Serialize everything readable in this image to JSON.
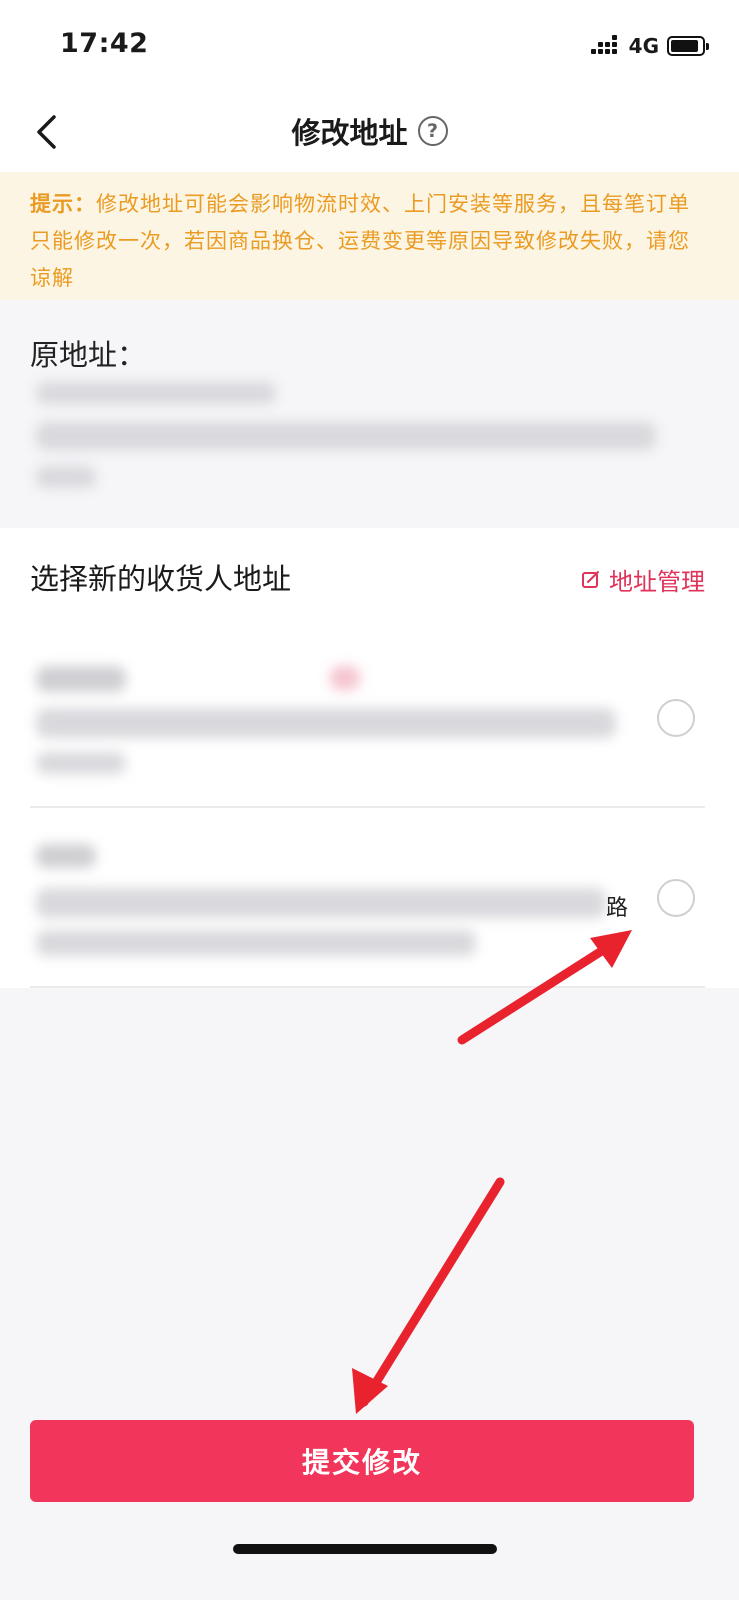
{
  "status_bar": {
    "time": "17:42",
    "network": "4G"
  },
  "header": {
    "title": "修改地址"
  },
  "notice": {
    "label": "提示：",
    "text": "修改地址可能会影响物流时效、上门安装等服务，且每笔订单只能修改一次，若因商品换仓、运费变更等原因导致修改失败，请您谅解"
  },
  "original_address": {
    "label": "原地址："
  },
  "new_address": {
    "title": "选择新的收货人地址",
    "manage_label": "地址管理",
    "items": [
      {
        "selected": false,
        "tail": ""
      },
      {
        "selected": false,
        "tail": "路"
      }
    ]
  },
  "submit": {
    "label": "提交修改"
  },
  "colors": {
    "accent": "#f2355a",
    "link": "#e0335a",
    "notice_text": "#ea9b23",
    "notice_bg": "#fdf5e3"
  },
  "icons": [
    "signal-icon",
    "battery-icon",
    "back-icon",
    "help-icon",
    "edit-icon",
    "radio-icon"
  ]
}
